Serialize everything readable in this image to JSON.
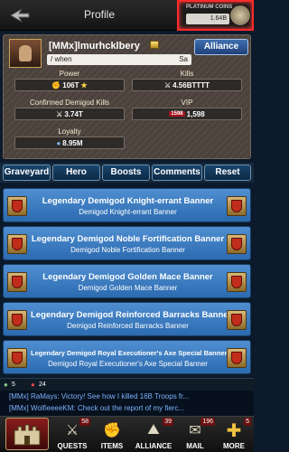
{
  "header": {
    "title": "Profile",
    "coins_label": "PLATINUM COINS",
    "coins_value": "1.64B"
  },
  "profile": {
    "name": "[MMx]lmurhcklbery",
    "motto": "/ when",
    "motto_tail": "Sa",
    "alliance_label": "Alliance",
    "stats": {
      "power_label": "Power",
      "power_value": "106T",
      "kills_label": "Kills",
      "kills_value": "4.56BTTTT",
      "confirmed_label": "Confirmed Demigod Kills",
      "confirmed_value": "3.74T",
      "vip_label": "VIP",
      "vip_badge": "1598",
      "vip_value": "1,598",
      "loyalty_label": "Loyalty",
      "loyalty_value": "8.95M"
    }
  },
  "tabs": [
    "Graveyard",
    "Hero",
    "Boosts",
    "Comments",
    "Reset"
  ],
  "banners": [
    {
      "title": "Legendary Demigod Knight-errant Banner",
      "subtitle": "Demigod Knight-errant Banner"
    },
    {
      "title": "Legendary Demigod Noble Fortification Banner",
      "subtitle": "Demigod Noble Fortification Banner"
    },
    {
      "title": "Legendary Demigod Golden Mace Banner",
      "subtitle": "Demigod Golden Mace Banner"
    },
    {
      "title": "Legendary Demigod Reinforced Barracks Banner",
      "subtitle": "Demigod Reinforced Barracks Banner"
    },
    {
      "title": "Legendary Demigod Royal Executioner's Axe Special Banner",
      "subtitle": "Demigod Royal Executioner's Axe Special Banner"
    }
  ],
  "status": {
    "users_count": "5",
    "messages_count": "24"
  },
  "chat": [
    "[MMx] RaMays: Victory! See how I killed 16B Troops fr...",
    "[MMx] WolfieeeeKM: Check out the report of my fierc..."
  ],
  "nav": {
    "quests_label": "QUESTS",
    "quests_badge": "58",
    "items_label": "ITEMS",
    "alliance_label": "ALLIANCE",
    "alliance_badge": "39",
    "mail_label": "MAIL",
    "mail_badge": "196",
    "more_label": "MORE",
    "more_badge": "5"
  },
  "colors": {
    "accent_blue": "#2c6bb0",
    "coin_border": "#ff2a2a"
  }
}
